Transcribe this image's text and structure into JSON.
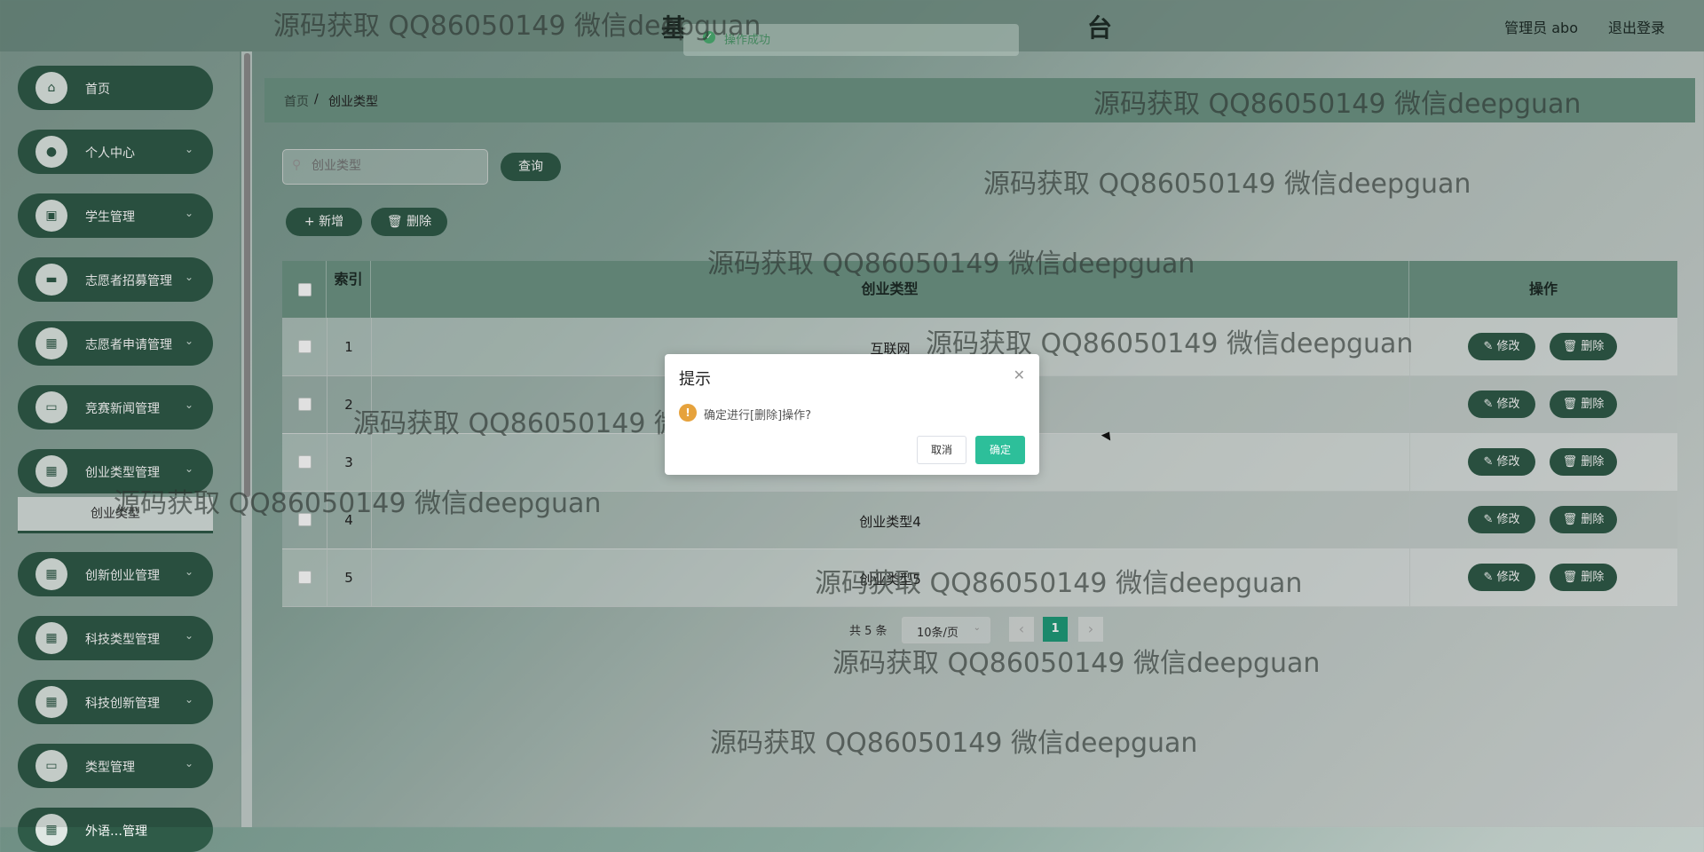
{
  "header": {
    "title": "基　　　　　　　　　　　　　　　台",
    "user": "管理员 abo",
    "logout": "退出登录"
  },
  "toast": {
    "text": "操作成功"
  },
  "sidebar": {
    "items": [
      {
        "label": "首页",
        "icon": "home-icon"
      },
      {
        "label": "个人中心",
        "icon": "user-icon"
      },
      {
        "label": "学生管理",
        "icon": "chart-icon"
      },
      {
        "label": "志愿者招募管理",
        "icon": "chat-icon"
      },
      {
        "label": "志愿者申请管理",
        "icon": "grid-icon"
      },
      {
        "label": "竞赛新闻管理",
        "icon": "monitor-icon"
      },
      {
        "label": "创业类型管理",
        "icon": "grid-icon"
      },
      {
        "label": "创新创业管理",
        "icon": "grid-icon"
      },
      {
        "label": "科技类型管理",
        "icon": "grid-icon"
      },
      {
        "label": "科技创新管理",
        "icon": "grid-icon"
      },
      {
        "label": "类型管理",
        "icon": "monitor-icon"
      },
      {
        "label": "外语…管理",
        "icon": "grid-icon"
      }
    ],
    "sub_item": "创业类型"
  },
  "breadcrumb": {
    "home": "首页",
    "separator": "/",
    "current": "创业类型"
  },
  "search": {
    "placeholder": "创业类型",
    "query_button": "查询"
  },
  "actions": {
    "add": "+ 新增",
    "delete": "删除"
  },
  "table": {
    "headers": {
      "index": "索引",
      "type": "创业类型",
      "operation": "操作"
    },
    "rows": [
      {
        "index": "1",
        "type": "互联网"
      },
      {
        "index": "2",
        "type": ""
      },
      {
        "index": "3",
        "type": ""
      },
      {
        "index": "4",
        "type": "创业类型4"
      },
      {
        "index": "5",
        "type": "创业类型5"
      }
    ],
    "edit_label": "修改",
    "delete_label": "删除"
  },
  "pagination": {
    "total": "共 5 条",
    "page_size": "10条/页",
    "current": "1"
  },
  "dialog": {
    "title": "提示",
    "message": "确定进行[删除]操作?",
    "cancel": "取消",
    "confirm": "确定"
  },
  "watermark": "源码获取 QQ86050149 微信deepguan",
  "colors": {
    "primary": "#2f5b48",
    "header": "#6e9485",
    "confirm": "#2dbf9a",
    "page_active": "#1f9c7a"
  }
}
